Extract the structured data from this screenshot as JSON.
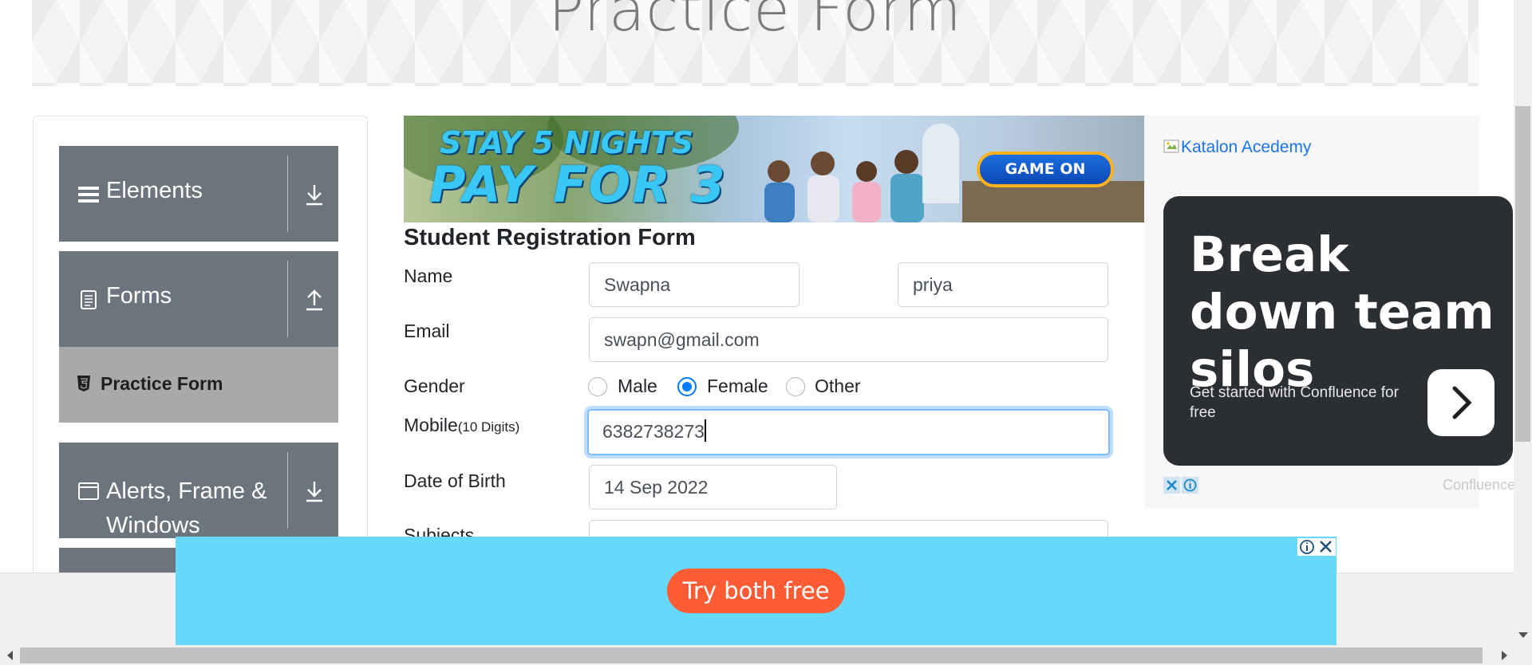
{
  "header": {
    "title": "Practice Form"
  },
  "sidebar": {
    "groups": [
      {
        "label": "Elements",
        "icon": "hamburger-icon",
        "arrow": "download-arrow-icon"
      },
      {
        "label": "Forms",
        "icon": "document-icon",
        "arrow": "upload-arrow-icon"
      },
      {
        "label_line1": "Alerts, Frame &",
        "label_line2": "Windows",
        "icon": "window-icon",
        "arrow": "download-arrow-icon"
      }
    ],
    "active_item": {
      "label": "Practice Form",
      "icon": "html5-icon"
    }
  },
  "banner_ad": {
    "line1": "STAY 5 NIGHTS",
    "line2": "PAY FOR 3",
    "button": "GAME ON"
  },
  "form": {
    "title": "Student Registration Form",
    "name_label": "Name",
    "first_name": "Swapna",
    "last_name": "priya",
    "email_label": "Email",
    "email": "swapn@gmail.com",
    "gender_label": "Gender",
    "gender_options": [
      "Male",
      "Female",
      "Other"
    ],
    "gender_selected": "Female",
    "mobile_label": "Mobile",
    "mobile_hint": "(10 Digits)",
    "mobile": "6382738273",
    "dob_label": "Date of Birth",
    "dob": "14 Sep 2022",
    "subjects_label": "Subjects"
  },
  "right_ad": {
    "broken_image_alt": "Katalon Acedemy",
    "headline": "Break down team silos",
    "subtext": "Get started with Confluence for free",
    "brand": "Confluence"
  },
  "bottom_ad": {
    "button": "Try both free"
  },
  "colors": {
    "sidebar_group": "#6c757d",
    "sidebar_active": "#a9a9a9",
    "radio_checked": "#007bff",
    "bottom_ad_bg": "#66d8fa",
    "cta_orange": "#ff5c35",
    "confluence_card": "#2b2f33"
  }
}
